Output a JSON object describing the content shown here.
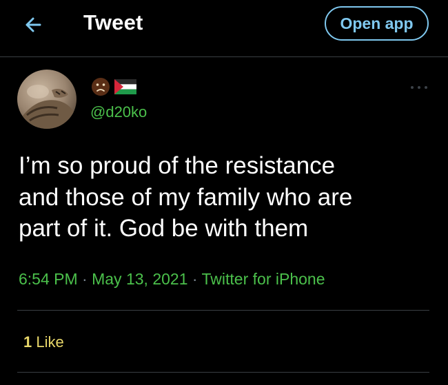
{
  "header": {
    "title": "Tweet",
    "back_icon": "arrow-left-icon",
    "open_app_label": "Open app"
  },
  "colors": {
    "background": "#000000",
    "accent": "#7fc8ef",
    "handle_green": "#4bc04b",
    "likes_yellow": "#e9d86a",
    "divider": "#3a3f44"
  },
  "tweet": {
    "display_name_icons": [
      "slightly-frowning-face-emoji",
      "palestine-flag-emoji"
    ],
    "handle": "@d20ko",
    "more_icon": "ellipsis-icon",
    "text_lines": [
      "I’m so proud of the resistance",
      "and those of my family who are",
      "part of it. God be with them"
    ],
    "time": "6:54 PM",
    "separator": "·",
    "date": "May 13, 2021",
    "source": "Twitter for iPhone",
    "likes_count": "1",
    "likes_label": "Like"
  }
}
